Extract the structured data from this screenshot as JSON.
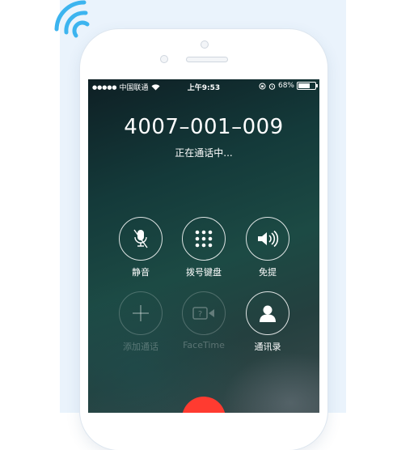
{
  "status_bar": {
    "carrier": "中国联通",
    "time": "上午9:53",
    "battery": "68%",
    "battery_level": 0.68
  },
  "call": {
    "number": "4007–001–009",
    "status": "正在通话中..."
  },
  "buttons": [
    {
      "label": "静音",
      "icon": "mute-icon"
    },
    {
      "label": "拨号键盘",
      "icon": "keypad-icon"
    },
    {
      "label": "免提",
      "icon": "speaker-icon"
    },
    {
      "label": "添加通话",
      "icon": "add-call-icon"
    },
    {
      "label": "FaceTime",
      "icon": "facetime-icon"
    },
    {
      "label": "通讯录",
      "icon": "contacts-icon"
    }
  ],
  "colors": {
    "end_call": "#ff3b30",
    "wifi_decoration": "#3cb4ef",
    "background_panel": "#eaf3fc"
  }
}
